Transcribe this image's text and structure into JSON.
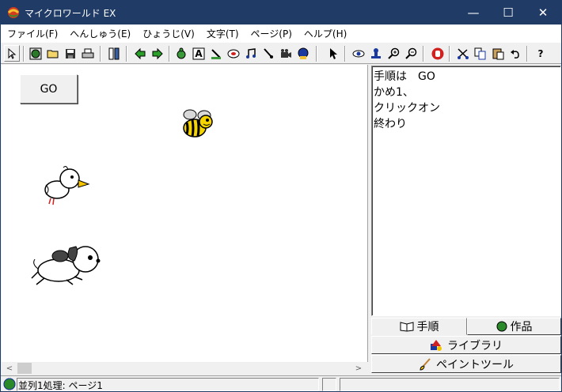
{
  "window": {
    "title": "マイクロワールド EX",
    "minimize_glyph": "—",
    "maximize_glyph": "☐",
    "close_glyph": "✕"
  },
  "menu": {
    "items": [
      {
        "label": "ファイル(F)"
      },
      {
        "label": "へんしゅう(E)"
      },
      {
        "label": "ひょうじ(V)"
      },
      {
        "label": "文字(T)"
      },
      {
        "label": "ページ(P)"
      },
      {
        "label": "ヘルプ(H)"
      }
    ]
  },
  "toolbar": {
    "text_tool_glyph": "A",
    "help_glyph": "?"
  },
  "canvas": {
    "go_button_label": "GO",
    "scroll_left": "<",
    "scroll_right": ">"
  },
  "script": {
    "lines": [
      "手順は　GO",
      "かめ1、",
      "クリックオン",
      "終わり"
    ]
  },
  "tabs": {
    "procedures": "手順",
    "project": "作品"
  },
  "buttons": {
    "library": "ライブラリ",
    "paint_tools": "ペイントツール"
  },
  "status": {
    "text": "並列1処理: ページ1"
  },
  "colors": {
    "titlebar": "#1f3b66",
    "canvas": "#ffffff",
    "bee_yellow": "#f5d400"
  }
}
